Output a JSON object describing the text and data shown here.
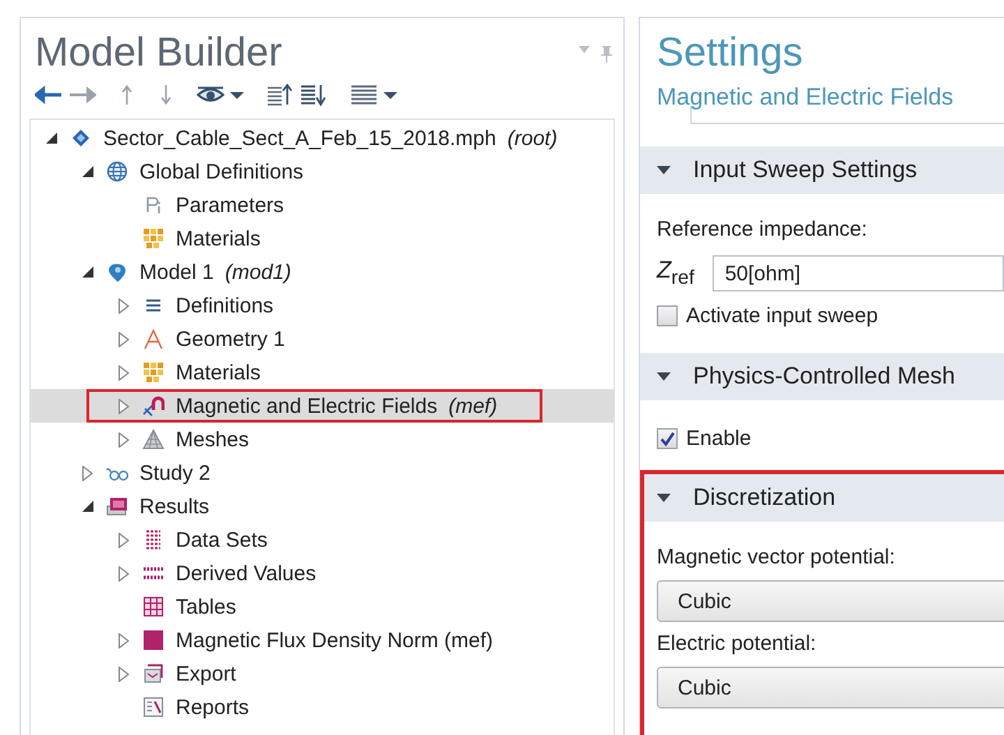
{
  "model_builder": {
    "title": "Model Builder",
    "tree": [
      {
        "label": "Sector_Cable_Sect_A_Feb_15_2018.mph",
        "note": "(root)",
        "kind": "file",
        "expanded": true,
        "selected": false,
        "children": [
          {
            "label": "Global Definitions",
            "kind": "globe",
            "expanded": true,
            "selected": false,
            "children": [
              {
                "label": "Parameters",
                "kind": "parameters",
                "selected": false
              },
              {
                "label": "Materials",
                "kind": "materials",
                "selected": false
              }
            ]
          },
          {
            "label": "Model 1",
            "note": "(mod1)",
            "kind": "model",
            "expanded": true,
            "selected": false,
            "children": [
              {
                "label": "Definitions",
                "kind": "definitions",
                "expanded": false,
                "selected": false
              },
              {
                "label": "Geometry 1",
                "kind": "geometry",
                "expanded": false,
                "selected": false
              },
              {
                "label": "Materials",
                "kind": "materials",
                "expanded": false,
                "selected": false
              },
              {
                "label": "Magnetic and Electric Fields",
                "note": "(mef)",
                "kind": "physics",
                "expanded": false,
                "selected": true
              },
              {
                "label": "Meshes",
                "kind": "mesh",
                "expanded": false,
                "selected": false
              }
            ]
          },
          {
            "label": "Study 2",
            "kind": "study",
            "expanded": false,
            "selected": false
          },
          {
            "label": "Results",
            "kind": "results",
            "expanded": true,
            "selected": false,
            "children": [
              {
                "label": "Data Sets",
                "kind": "datasets",
                "expanded": false,
                "selected": false
              },
              {
                "label": "Derived Values",
                "kind": "derived",
                "expanded": false,
                "selected": false
              },
              {
                "label": "Tables",
                "kind": "tables",
                "selected": false
              },
              {
                "label": "Magnetic Flux Density Norm (mef)",
                "kind": "plot",
                "expanded": false,
                "selected": false
              },
              {
                "label": "Export",
                "kind": "export",
                "expanded": false,
                "selected": false
              },
              {
                "label": "Reports",
                "kind": "reports",
                "selected": false
              }
            ]
          }
        ]
      }
    ]
  },
  "settings": {
    "title": "Settings",
    "subtitle": "Magnetic and Electric Fields",
    "sections": [
      {
        "title": "Input Sweep Settings",
        "outlined": false,
        "items": [
          {
            "kind": "label",
            "text": "Reference impedance:"
          },
          {
            "kind": "field",
            "label": "*Z*$_{ref}$",
            "value": "50[ohm]"
          },
          {
            "kind": "checkbox",
            "label": "Activate input sweep",
            "checked": false
          }
        ]
      },
      {
        "title": "Physics-Controlled Mesh",
        "outlined": false,
        "items": [
          {
            "kind": "checkbox",
            "label": "Enable",
            "checked": true
          }
        ]
      },
      {
        "title": "Discretization",
        "outlined": true,
        "items": [
          {
            "kind": "label",
            "text": "Magnetic vector potential:"
          },
          {
            "kind": "select",
            "value": "Cubic"
          },
          {
            "kind": "label",
            "text": "Electric potential:"
          },
          {
            "kind": "select",
            "value": "Cubic"
          }
        ]
      }
    ]
  }
}
